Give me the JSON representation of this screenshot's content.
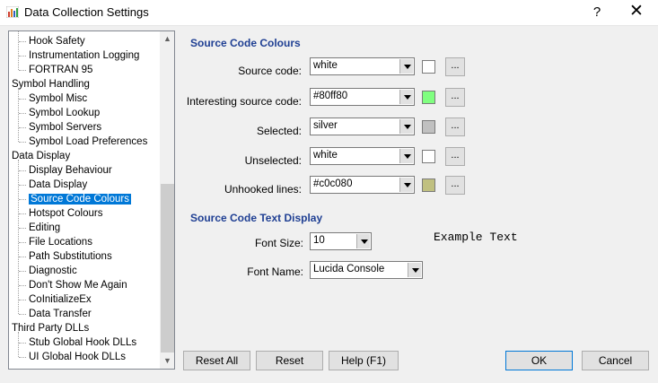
{
  "window": {
    "title": "Data Collection Settings",
    "help_label": "?",
    "close_label": "✕"
  },
  "tree": {
    "items": [
      {
        "label": "Hook Safety",
        "level": "child"
      },
      {
        "label": "Instrumentation Logging",
        "level": "child"
      },
      {
        "label": "FORTRAN 95",
        "level": "child"
      },
      {
        "label": "Symbol Handling",
        "level": "category"
      },
      {
        "label": "Symbol Misc",
        "level": "child"
      },
      {
        "label": "Symbol Lookup",
        "level": "child"
      },
      {
        "label": "Symbol Servers",
        "level": "child"
      },
      {
        "label": "Symbol Load Preferences",
        "level": "child"
      },
      {
        "label": "Data Display",
        "level": "category"
      },
      {
        "label": "Display Behaviour",
        "level": "child"
      },
      {
        "label": "Data Display",
        "level": "child"
      },
      {
        "label": "Source Code Colours",
        "level": "child",
        "selected": true
      },
      {
        "label": "Hotspot Colours",
        "level": "child"
      },
      {
        "label": "Editing",
        "level": "child"
      },
      {
        "label": "File Locations",
        "level": "child"
      },
      {
        "label": "Path Substitutions",
        "level": "child"
      },
      {
        "label": "Diagnostic",
        "level": "child"
      },
      {
        "label": "Don't Show Me Again",
        "level": "child"
      },
      {
        "label": "CoInitializeEx",
        "level": "child"
      },
      {
        "label": "Data Transfer",
        "level": "child"
      },
      {
        "label": "Third Party DLLs",
        "level": "category"
      },
      {
        "label": "Stub Global Hook DLLs",
        "level": "child"
      },
      {
        "label": "UI Global Hook DLLs",
        "level": "child"
      }
    ]
  },
  "colours": {
    "heading": "Source Code Colours",
    "rows": [
      {
        "label": "Source code:",
        "value": "white",
        "swatch": "#ffffff",
        "button": "..."
      },
      {
        "label": "Interesting source code:",
        "value": "#80ff80",
        "swatch": "#80ff80",
        "button": "..."
      },
      {
        "label": "Selected:",
        "value": "silver",
        "swatch": "#c0c0c0",
        "button": "..."
      },
      {
        "label": "Unselected:",
        "value": "white",
        "swatch": "#ffffff",
        "button": "..."
      },
      {
        "label": "Unhooked lines:",
        "value": "#c0c080",
        "swatch": "#c0c080",
        "button": "..."
      }
    ]
  },
  "text_display": {
    "heading": "Source Code Text Display",
    "font_size_label": "Font Size:",
    "font_size_value": "10",
    "font_name_label": "Font Name:",
    "font_name_value": "Lucida Console",
    "example_text": "Example Text"
  },
  "buttons": {
    "reset_all": "Reset All",
    "reset": "Reset",
    "help": "Help (F1)",
    "ok": "OK",
    "cancel": "Cancel"
  }
}
